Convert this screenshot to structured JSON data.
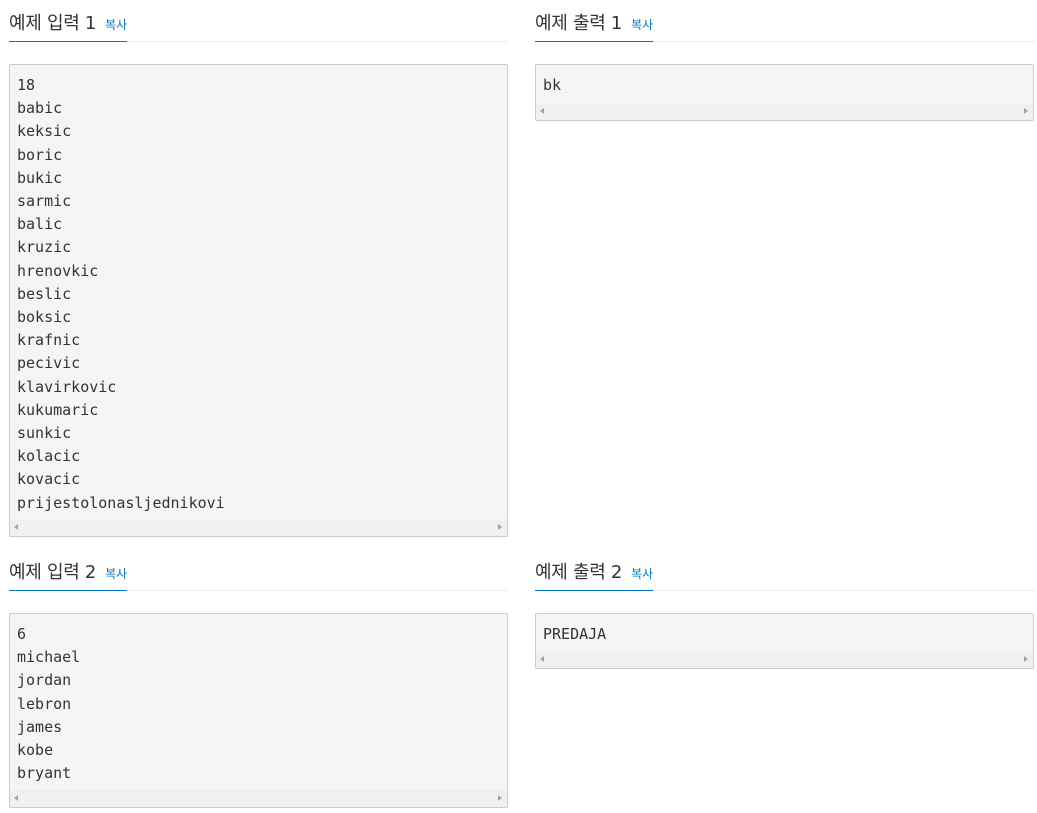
{
  "samples": [
    {
      "title": "예제 입력 1",
      "copy_label": "복사",
      "content": "18\nbabic\nkeksic\nboric\nbukic\nsarmic\nbalic\nkruzic\nhrenovkic\nbeslic\nboksic\nkrafnic\npecivic\nklavirkovic\nkukumaric\nsunkic\nkolacic\nkovacic\nprijestolonasljednikovi"
    },
    {
      "title": "예제 출력 1",
      "copy_label": "복사",
      "content": "bk"
    },
    {
      "title": "예제 입력 2",
      "copy_label": "복사",
      "content": "6\nmichael\njordan\nlebron\njames\nkobe\nbryant"
    },
    {
      "title": "예제 출력 2",
      "copy_label": "복사",
      "content": "PREDAJA"
    }
  ],
  "colors": {
    "accent": "#0076c0",
    "pre_background": "#f5f5f7",
    "pre_border": "#cccccc",
    "divider": "#eeeeee"
  }
}
